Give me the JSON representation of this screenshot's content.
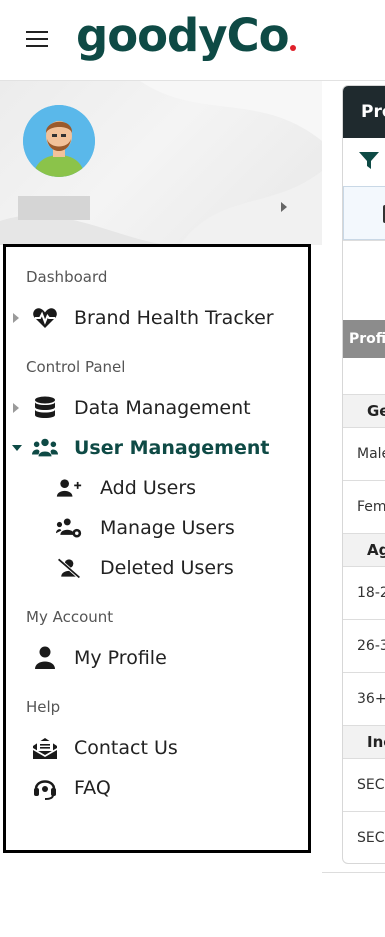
{
  "brand": {
    "logo_text": "goodyCo",
    "accent_dot": "#e0202a",
    "primary": "#0e4a45"
  },
  "sidebar": {
    "sections": [
      {
        "label": "Dashboard"
      },
      {
        "label": "Control Panel"
      },
      {
        "label": "My Account"
      },
      {
        "label": "Help"
      }
    ],
    "items": {
      "brand_health": "Brand Health Tracker",
      "data_management": "Data Management",
      "user_management": "User Management",
      "add_users": "Add Users",
      "manage_users": "Manage Users",
      "deleted_users": "Deleted Users",
      "my_profile": "My Profile",
      "contact_us": "Contact Us",
      "faq": "FAQ"
    }
  },
  "panel": {
    "header": "Pro",
    "rows": {
      "profile_head": "Profi",
      "gender": "Ge",
      "male": "Male",
      "female": "Fem",
      "age": "Ag",
      "age1": "18-2",
      "age2": "26-3",
      "age3": "36+",
      "income": "Inc",
      "sec1": "SEC",
      "sec2": "SEC"
    }
  }
}
